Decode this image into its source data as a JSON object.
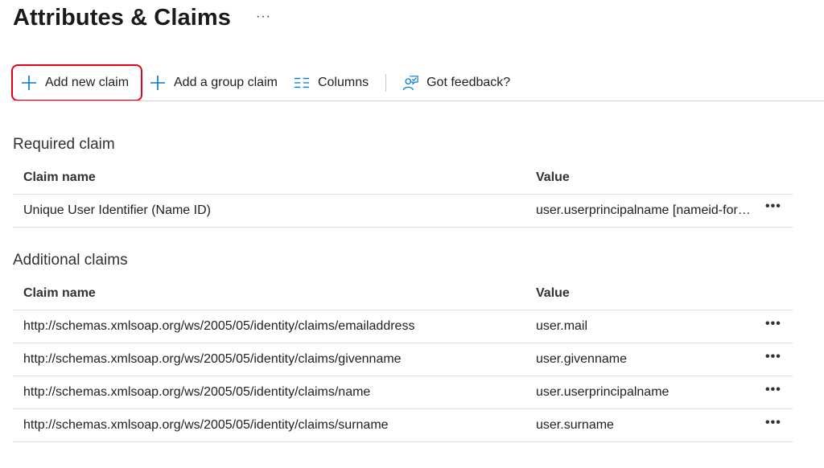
{
  "header": {
    "title": "Attributes & Claims",
    "more_label": "···"
  },
  "toolbar": {
    "add_claim_label": "Add new claim",
    "add_group_claim_label": "Add a group claim",
    "columns_label": "Columns",
    "feedback_label": "Got feedback?",
    "highlight_color": "#e3001b",
    "accent_color": "#0078d4"
  },
  "required": {
    "title": "Required claim",
    "columns": [
      "Claim name",
      "Value"
    ],
    "rows": [
      {
        "name": "Unique User Identifier (Name ID)",
        "value": "user.userprincipalname [nameid-format:emailAddress]",
        "more": "•••"
      }
    ]
  },
  "additional": {
    "title": "Additional claims",
    "columns": [
      "Claim name",
      "Value"
    ],
    "rows": [
      {
        "name": "http://schemas.xmlsoap.org/ws/2005/05/identity/claims/emailaddress",
        "value": "user.mail",
        "more": "•••"
      },
      {
        "name": "http://schemas.xmlsoap.org/ws/2005/05/identity/claims/givenname",
        "value": "user.givenname",
        "more": "•••"
      },
      {
        "name": "http://schemas.xmlsoap.org/ws/2005/05/identity/claims/name",
        "value": "user.userprincipalname",
        "more": "•••"
      },
      {
        "name": "http://schemas.xmlsoap.org/ws/2005/05/identity/claims/surname",
        "value": "user.surname",
        "more": "•••"
      }
    ]
  }
}
